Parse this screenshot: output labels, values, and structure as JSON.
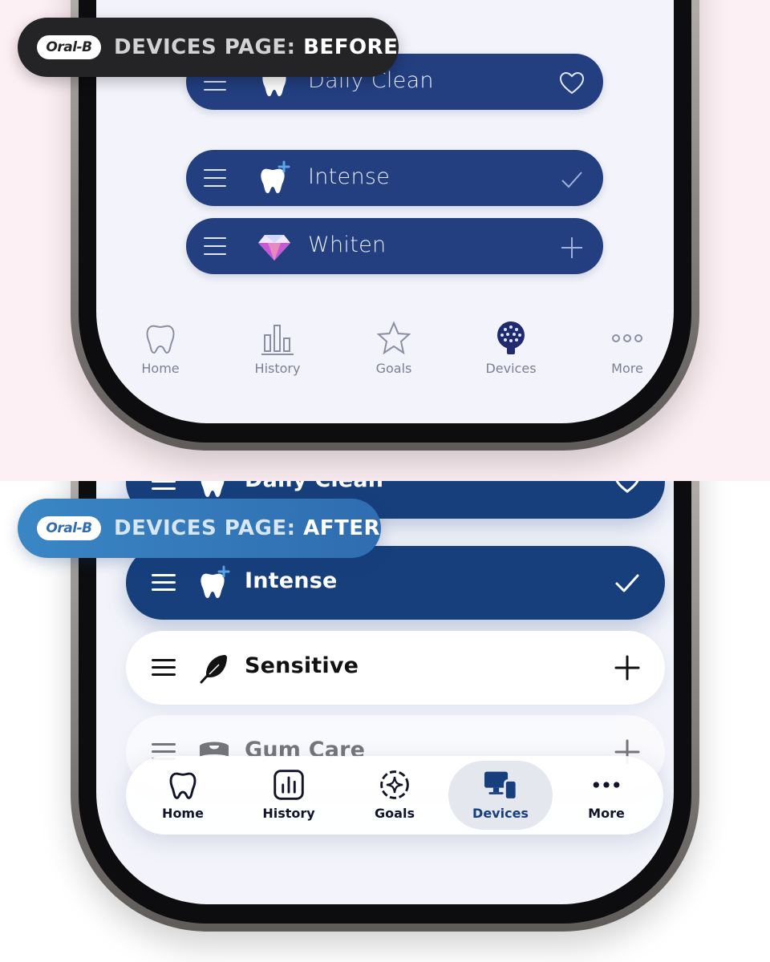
{
  "before": {
    "badge": {
      "logo": "Oral-B",
      "label": "DEVICES PAGE: ",
      "emphasis": "BEFORE"
    },
    "modes": [
      {
        "label": "Daily Clean",
        "icon": "tooth-refresh-icon",
        "right_icon": "heart-icon"
      },
      {
        "label": "Intense",
        "icon": "tooth-plus-icon",
        "right_icon": "check-icon"
      },
      {
        "label": "Whiten",
        "icon": "diamond-icon",
        "right_icon": "plus-icon"
      }
    ],
    "nav": [
      {
        "label": "Home",
        "icon": "tooth-icon"
      },
      {
        "label": "History",
        "icon": "bar-chart-icon"
      },
      {
        "label": "Goals",
        "icon": "star-icon"
      },
      {
        "label": "Devices",
        "icon": "brush-head-icon",
        "active": true
      },
      {
        "label": "More",
        "icon": "more-dots-icon"
      }
    ]
  },
  "after": {
    "badge": {
      "logo": "Oral-B",
      "label": "DEVICES PAGE: ",
      "emphasis": "AFTER"
    },
    "modes": [
      {
        "label": "Daily Clean",
        "icon": "tooth-refresh-icon",
        "right_icon": "heart-icon",
        "selected": true
      },
      {
        "label": "Intense",
        "icon": "tooth-plus-icon",
        "right_icon": "check-icon",
        "selected": true
      },
      {
        "label": "Sensitive",
        "icon": "feather-icon",
        "right_icon": "plus-icon",
        "selected": false
      },
      {
        "label": "Gum Care",
        "icon": "gum-icon",
        "right_icon": "plus-icon",
        "selected": false
      }
    ],
    "nav": [
      {
        "label": "Home",
        "icon": "tooth-icon"
      },
      {
        "label": "History",
        "icon": "bar-chart-icon"
      },
      {
        "label": "Goals",
        "icon": "goals-sparkle-icon"
      },
      {
        "label": "Devices",
        "icon": "devices-icon",
        "active": true
      },
      {
        "label": "More",
        "icon": "more-dots-icon"
      }
    ]
  },
  "colors": {
    "before_pill": "#233f80",
    "after_pill_dark": "#173f7b",
    "after_badge": "#2f6db0",
    "before_badge": "#242426"
  }
}
